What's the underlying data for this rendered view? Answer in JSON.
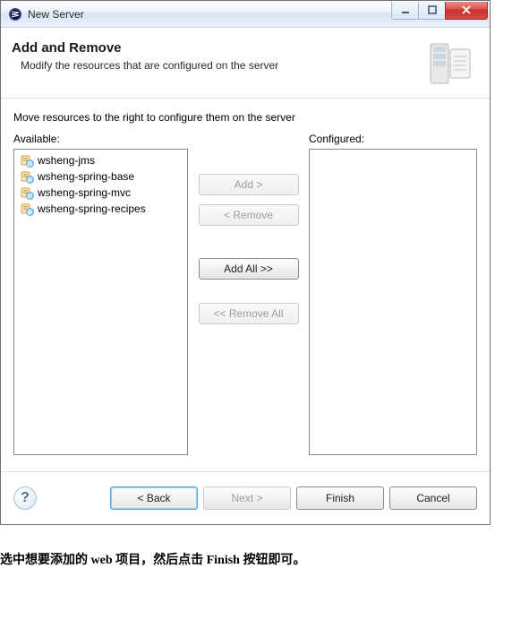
{
  "window": {
    "title": "New Server",
    "min_label": "Minimize",
    "max_label": "Maximize",
    "close_label": "Close"
  },
  "header": {
    "title": "Add and Remove",
    "subtitle": "Modify the resources that are configured on the server"
  },
  "body": {
    "instruction": "Move resources to the right to configure them on the server",
    "available_label": "Available:",
    "configured_label": "Configured:"
  },
  "available_items": [
    {
      "label": "wsheng-jms"
    },
    {
      "label": "wsheng-spring-base"
    },
    {
      "label": "wsheng-spring-mvc"
    },
    {
      "label": "wsheng-spring-recipes"
    }
  ],
  "configured_items": [],
  "shuttle": {
    "add": "Add >",
    "remove": "< Remove",
    "add_all": "Add All >>",
    "remove_all": "<< Remove All"
  },
  "footer": {
    "back": "< Back",
    "next": "Next >",
    "finish": "Finish",
    "cancel": "Cancel",
    "help": "?"
  },
  "caption": "选中想要添加的 web 项目，然后点击 Finish 按钮即可。"
}
